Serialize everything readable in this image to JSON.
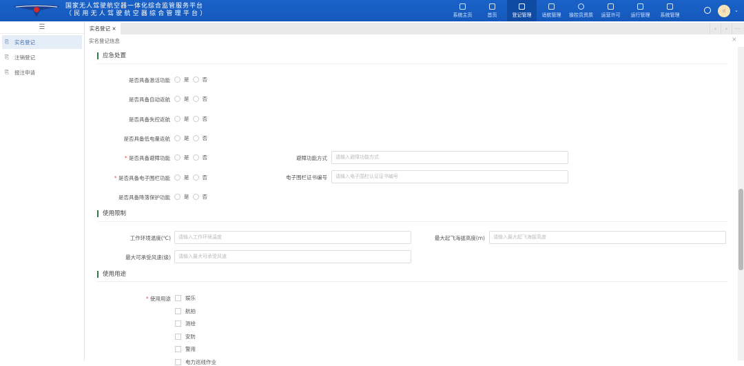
{
  "header": {
    "title_line1": "国家无人驾驶航空器一体化综合监管服务平台",
    "title_line2": "（民用无人驾驶航空器综合管理平台）",
    "avatar": "d",
    "nav": [
      {
        "label": "系统主页"
      },
      {
        "label": "首页"
      },
      {
        "label": "登记管理",
        "active": true
      },
      {
        "label": "适航管理"
      },
      {
        "label": "操控员资质"
      },
      {
        "label": "运营许可"
      },
      {
        "label": "运行管理"
      },
      {
        "label": "系统管理"
      }
    ]
  },
  "sidebar": {
    "items": [
      {
        "label": "实名登记"
      },
      {
        "label": "注销登记"
      },
      {
        "label": "报注申请"
      }
    ]
  },
  "tabs": {
    "active": "实名登记"
  },
  "breadcrumb": "实名登记信息",
  "sections": {
    "emergency": {
      "title": "应急处置",
      "yes": "是",
      "no": "否",
      "rows": [
        {
          "label": "是否具备激活功能"
        },
        {
          "label": "是否具备自动返航"
        },
        {
          "label": "是否具备失控返航"
        },
        {
          "label": "是否具备低电量返航"
        },
        {
          "label": "是否具备避障功能",
          "required": true
        },
        {
          "label": "是否具备电子围栏功能",
          "required": true
        },
        {
          "label": "是否具备降落保护功能"
        }
      ],
      "obstacle_mode": {
        "label": "避障功能方式",
        "placeholder": "请输入避障功能方式"
      },
      "fence_cert": {
        "label": "电子围栏证书编号",
        "placeholder": "请输入电子围栏认证证书编号"
      }
    },
    "limits": {
      "title": "使用限制",
      "temperature": {
        "label": "工作环境温度(℃)",
        "placeholder": "请输入工作环境温度"
      },
      "altitude": {
        "label": "最大起飞海拔高度(m)",
        "placeholder": "请输入最大起飞海拔高度"
      },
      "wind": {
        "label": "最大可承受风速(级)",
        "placeholder": "请输入最大可承受风速"
      }
    },
    "usage": {
      "title": "使用用途",
      "label": "使用用途",
      "options": [
        "娱乐",
        "航拍",
        "测绘",
        "安防",
        "警用",
        "电力巡线作业"
      ]
    }
  }
}
